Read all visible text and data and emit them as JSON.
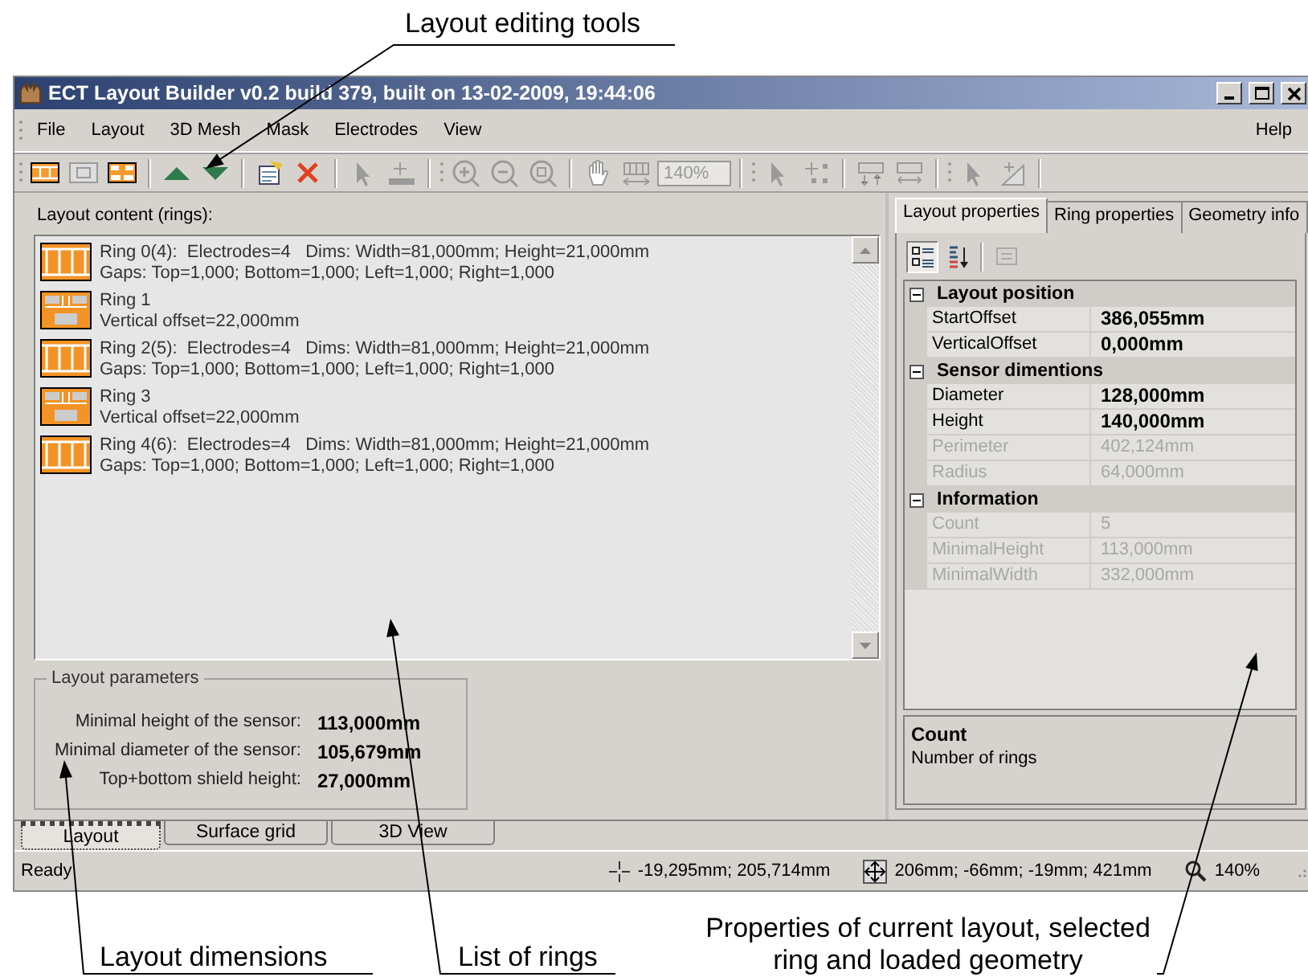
{
  "annotations": {
    "top": "Layout editing tools",
    "bottom": [
      "Layout dimensions",
      "List of rings",
      "Properties of current layout, selected ring and loaded geometry"
    ]
  },
  "window": {
    "title": "ECT Layout Builder v0.2 build 379, built on 13-02-2009, 19:44:06"
  },
  "menu": [
    "File",
    "Layout",
    "3D Mesh",
    "Mask",
    "Electrodes",
    "View"
  ],
  "help_menu": "Help",
  "toolbar": [
    {
      "kind": "grip"
    },
    {
      "kind": "ring-electrode",
      "disabled": false
    },
    {
      "kind": "ring-blank",
      "disabled": true
    },
    {
      "kind": "ring-gap",
      "disabled": false
    },
    {
      "kind": "separator"
    },
    {
      "kind": "move-up",
      "disabled": false
    },
    {
      "kind": "move-down",
      "disabled": false
    },
    {
      "kind": "separator"
    },
    {
      "kind": "properties",
      "disabled": false
    },
    {
      "kind": "delete",
      "disabled": false
    },
    {
      "kind": "separator"
    },
    {
      "kind": "pointer",
      "disabled": true
    },
    {
      "kind": "add-marker",
      "disabled": true
    },
    {
      "kind": "separator"
    },
    {
      "kind": "grip"
    },
    {
      "kind": "zoom-in",
      "disabled": true
    },
    {
      "kind": "zoom-out",
      "disabled": true
    },
    {
      "kind": "zoom-fit",
      "disabled": true
    },
    {
      "kind": "separator"
    },
    {
      "kind": "hand",
      "disabled": true
    },
    {
      "kind": "fit-width",
      "disabled": true
    },
    {
      "kind": "zoom-field",
      "value": "140%",
      "disabled": true
    },
    {
      "kind": "separator"
    },
    {
      "kind": "grip"
    },
    {
      "kind": "pointer",
      "disabled": true
    },
    {
      "kind": "select-points",
      "disabled": true
    },
    {
      "kind": "separator"
    },
    {
      "kind": "split-vertical",
      "disabled": true
    },
    {
      "kind": "split-horizontal",
      "disabled": true
    },
    {
      "kind": "separator"
    },
    {
      "kind": "grip"
    },
    {
      "kind": "pointer",
      "disabled": true
    },
    {
      "kind": "angle",
      "disabled": true
    },
    {
      "kind": "separator"
    }
  ],
  "layout_content": {
    "label": "Layout content (rings):",
    "rings": [
      {
        "kind": "electrode",
        "lines": [
          "Ring 0(4):  Electrodes=4   Dims: Width=81,000mm; Height=21,000mm",
          "Gaps: Top=1,000; Bottom=1,000; Left=1,000; Right=1,000"
        ]
      },
      {
        "kind": "gap",
        "lines": [
          "Ring 1",
          "Vertical offset=22,000mm"
        ]
      },
      {
        "kind": "electrode",
        "lines": [
          "Ring 2(5):  Electrodes=4   Dims: Width=81,000mm; Height=21,000mm",
          "Gaps: Top=1,000; Bottom=1,000; Left=1,000; Right=1,000"
        ]
      },
      {
        "kind": "gap",
        "lines": [
          "Ring 3",
          "Vertical offset=22,000mm"
        ]
      },
      {
        "kind": "electrode",
        "lines": [
          "Ring 4(6):  Electrodes=4   Dims: Width=81,000mm; Height=21,000mm",
          "Gaps: Top=1,000; Bottom=1,000; Left=1,000; Right=1,000"
        ]
      }
    ]
  },
  "layout_parameters": {
    "title": "Layout parameters",
    "rows": [
      {
        "label": "Minimal height of the sensor:",
        "value": "113,000mm"
      },
      {
        "label": "Minimal diameter of the sensor:",
        "value": "105,679mm"
      },
      {
        "label": "Top+bottom shield height:",
        "value": "27,000mm"
      }
    ]
  },
  "property_tabs": [
    {
      "label": "Layout properties",
      "selected": true
    },
    {
      "label": "Ring properties",
      "selected": false
    },
    {
      "label": "Geometry info",
      "selected": false
    }
  ],
  "grid_toolbar": [
    {
      "kind": "categorized",
      "selected": true,
      "disabled": false
    },
    {
      "kind": "alphabetical",
      "selected": false,
      "disabled": false
    },
    {
      "kind": "property-pages",
      "selected": false,
      "disabled": true
    }
  ],
  "properties": [
    {
      "category": "Layout position",
      "expanded": true,
      "rows": [
        {
          "name": "StartOffset",
          "value": "386,055mm",
          "read_only": false
        },
        {
          "name": "VerticalOffset",
          "value": "0,000mm",
          "read_only": false
        }
      ]
    },
    {
      "category": "Sensor dimentions",
      "expanded": true,
      "rows": [
        {
          "name": "Diameter",
          "value": "128,000mm",
          "read_only": false
        },
        {
          "name": "Height",
          "value": "140,000mm",
          "read_only": false
        },
        {
          "name": "Perimeter",
          "value": "402,124mm",
          "read_only": true
        },
        {
          "name": "Radius",
          "value": "64,000mm",
          "read_only": true
        }
      ]
    },
    {
      "category": "Information",
      "expanded": true,
      "rows": [
        {
          "name": "Count",
          "value": "5",
          "read_only": true
        },
        {
          "name": "MinimalHeight",
          "value": "113,000mm",
          "read_only": true
        },
        {
          "name": "MinimalWidth",
          "value": "332,000mm",
          "read_only": true
        }
      ]
    }
  ],
  "description": {
    "title": "Count",
    "text": "Number of rings"
  },
  "view_tabs": [
    {
      "label": "Layout",
      "selected": true
    },
    {
      "label": "Surface grid",
      "selected": false
    },
    {
      "label": "3D View",
      "selected": false
    }
  ],
  "status_bar": {
    "text": "Ready",
    "items": [
      {
        "kind": "cursor",
        "text": "-19,295mm; 205,714mm"
      },
      {
        "kind": "extent",
        "text": "206mm; -66mm; -19mm; 421mm"
      },
      {
        "kind": "zoom",
        "text": "140%"
      }
    ]
  }
}
